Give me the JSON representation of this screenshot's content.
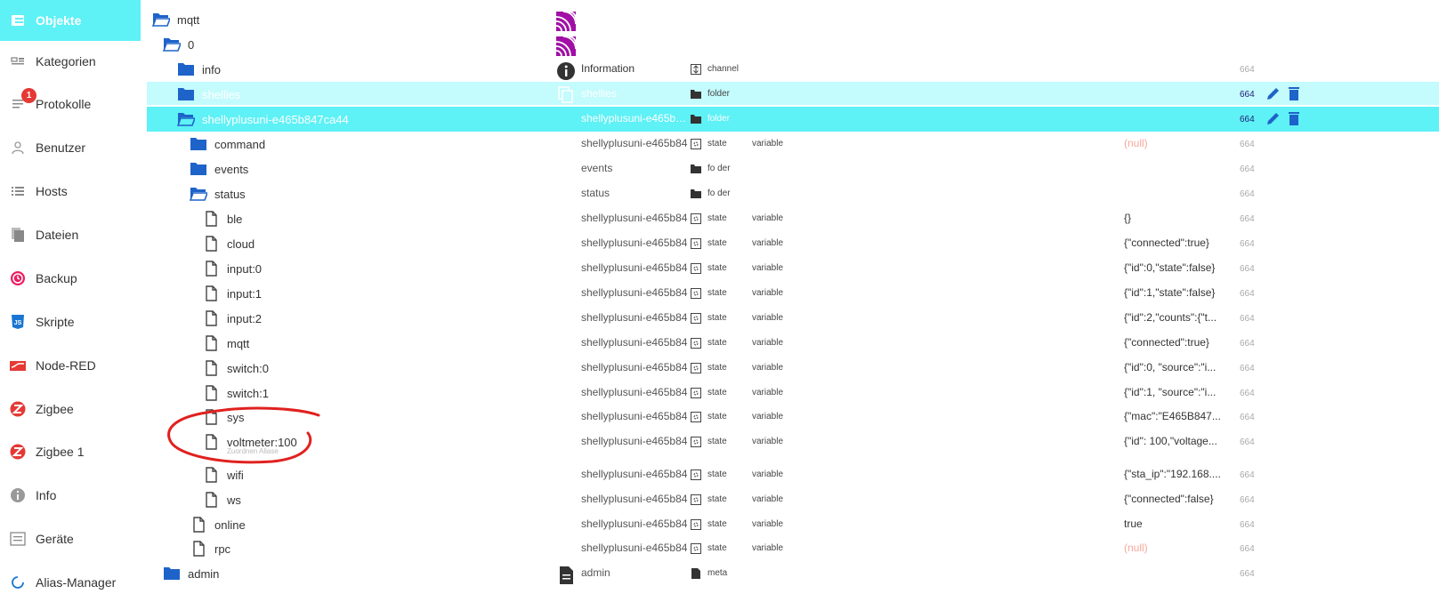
{
  "sidebar": {
    "items": [
      {
        "label": "Objekte",
        "icon": "objects-icon",
        "active": true
      },
      {
        "label": "Kategorien",
        "icon": "categories-icon"
      },
      {
        "label": "Protokolle",
        "icon": "logs-icon",
        "badge": "1"
      },
      {
        "label": "Benutzer",
        "icon": "user-icon"
      },
      {
        "label": "Hosts",
        "icon": "hosts-icon"
      },
      {
        "label": "Dateien",
        "icon": "files-icon"
      },
      {
        "label": "Backup",
        "icon": "backup-icon"
      },
      {
        "label": "Skripte",
        "icon": "js-icon"
      },
      {
        "label": "Node-RED",
        "icon": "nodered-icon"
      },
      {
        "label": "Zigbee",
        "icon": "zigbee-icon"
      },
      {
        "label": "Zigbee 1",
        "icon": "zigbee-icon"
      },
      {
        "label": "Info",
        "icon": "info-icon"
      },
      {
        "label": "Geräte",
        "icon": "devices-icon"
      },
      {
        "label": "Alias-Manager",
        "icon": "alias-icon"
      }
    ]
  },
  "tree": {
    "rows": [
      {
        "name": "mqtt",
        "icon": "folder-open-icon",
        "room_icon": "mqtt-logo-icon"
      },
      {
        "name": "0",
        "icon": "folder-open-icon",
        "room_icon": "mqtt-logo-icon"
      },
      {
        "name": "info",
        "icon": "folder-icon",
        "room_icon": "info-circle-icon",
        "common_name": "Information",
        "type_icon": "channel-icon",
        "type": "channel",
        "acl": "664"
      },
      {
        "name": "shellies",
        "icon": "folder-icon",
        "room_icon": "copy-icon",
        "common_name": "shellies",
        "type_icon": "folder-small-icon",
        "type": "folder",
        "acl": "664",
        "actions": true
      },
      {
        "name": "shellyplusuni-e465b847ca44",
        "icon": "folder-open-icon",
        "common_name": "shellyplusuni-e465b…",
        "type_icon": "folder-small-icon",
        "type": "folder",
        "acl": "664",
        "actions": true
      },
      {
        "name": "command",
        "icon": "folder-icon",
        "common_name": "shellyplusuni-e465b84",
        "type_icon": "state-icon",
        "type": "state",
        "role": "variable",
        "value": "(null)",
        "acl": "664"
      },
      {
        "name": "events",
        "icon": "folder-icon",
        "common_name": "events",
        "type_icon": "folder-small-icon",
        "type": "fo der",
        "acl": "664"
      },
      {
        "name": "status",
        "icon": "folder-open-icon",
        "common_name": "status",
        "type_icon": "folder-small-icon",
        "type": "fo der",
        "acl": "664"
      },
      {
        "name": "ble",
        "icon": "file-icon",
        "common_name": "shellyplusuni-e465b84",
        "type_icon": "state-icon",
        "type": "state",
        "role": "variable",
        "value": "{}",
        "acl": "664"
      },
      {
        "name": "cloud",
        "icon": "file-icon",
        "common_name": "shellyplusuni-e465b84",
        "type_icon": "state-icon",
        "type": "state",
        "role": "variable",
        "value": "{\"connected\":true}",
        "acl": "664"
      },
      {
        "name": "input:0",
        "icon": "file-icon",
        "common_name": "shellyplusuni-e465b84",
        "type_icon": "state-icon",
        "type": "state",
        "role": "variable",
        "value": "{\"id\":0,\"state\":false}",
        "acl": "664"
      },
      {
        "name": "input:1",
        "icon": "file-icon",
        "common_name": "shellyplusuni-e465b84",
        "type_icon": "state-icon",
        "type": "state",
        "role": "variable",
        "value": "{\"id\":1,\"state\":false}",
        "acl": "664"
      },
      {
        "name": "input:2",
        "icon": "file-icon",
        "common_name": "shellyplusuni-e465b84",
        "type_icon": "state-icon",
        "type": "state",
        "role": "variable",
        "value": "{\"id\":2,\"counts\":{\"t...",
        "acl": "664"
      },
      {
        "name": "mqtt",
        "icon": "file-icon",
        "common_name": "shellyplusuni-e465b84",
        "type_icon": "state-icon",
        "type": "state",
        "role": "variable",
        "value": "{\"connected\":true}",
        "acl": "664"
      },
      {
        "name": "switch:0",
        "icon": "file-icon",
        "common_name": "shellyplusuni-e465b84",
        "type_icon": "state-icon",
        "type": "state",
        "role": "variable",
        "value": "{\"id\":0, \"source\":\"i...",
        "acl": "664"
      },
      {
        "name": "switch:1",
        "icon": "file-icon",
        "common_name": "shellyplusuni-e465b84",
        "type_icon": "state-icon",
        "type": "state",
        "role": "variable",
        "value": "{\"id\":1, \"source\":\"i...",
        "acl": "664"
      },
      {
        "name": "sys",
        "icon": "file-icon",
        "common_name": "shellyplusuni-e465b84",
        "type_icon": "state-icon",
        "type": "state",
        "role": "variable",
        "value": "{\"mac\":\"E465B847...",
        "acl": "664"
      },
      {
        "name": "voltmeter:100",
        "sub": "Zuordnen Aliase",
        "icon": "file-icon",
        "common_name": "shellyplusuni-e465b84",
        "type_icon": "state-icon",
        "type": "state",
        "role": "variable",
        "value": "{\"id\": 100,\"voltage...",
        "acl": "664"
      },
      {
        "name": "wifi",
        "icon": "file-icon",
        "common_name": "shellyplusuni-e465b84",
        "type_icon": "state-icon",
        "type": "state",
        "role": "variable",
        "value": "{\"sta_ip\":\"192.168....",
        "acl": "664"
      },
      {
        "name": "ws",
        "icon": "file-icon",
        "common_name": "shellyplusuni-e465b84",
        "type_icon": "state-icon",
        "type": "state",
        "role": "variable",
        "value": "{\"connected\":false}",
        "acl": "664"
      },
      {
        "name": "online",
        "icon": "file-icon",
        "common_name": "shellyplusuni-e465b84",
        "type_icon": "state-icon",
        "type": "state",
        "role": "variable",
        "value": "true",
        "acl": "664"
      },
      {
        "name": "rpc",
        "icon": "file-icon",
        "common_name": "shellyplusuni-e465b84",
        "type_icon": "state-icon",
        "type": "state",
        "role": "variable",
        "value": "(null)",
        "acl": "664"
      },
      {
        "name": "admin",
        "icon": "folder-icon",
        "room_icon": "document-icon",
        "common_name": "admin",
        "type_icon": "document-small-icon",
        "type": "meta",
        "acl": "664"
      }
    ]
  },
  "colors": {
    "accent": "#5ef1f6",
    "folder": "#1e63c9",
    "annotation": "#e0211f",
    "mqtt_logo": "#a10fa5",
    "null_value": "#f5a99c"
  }
}
